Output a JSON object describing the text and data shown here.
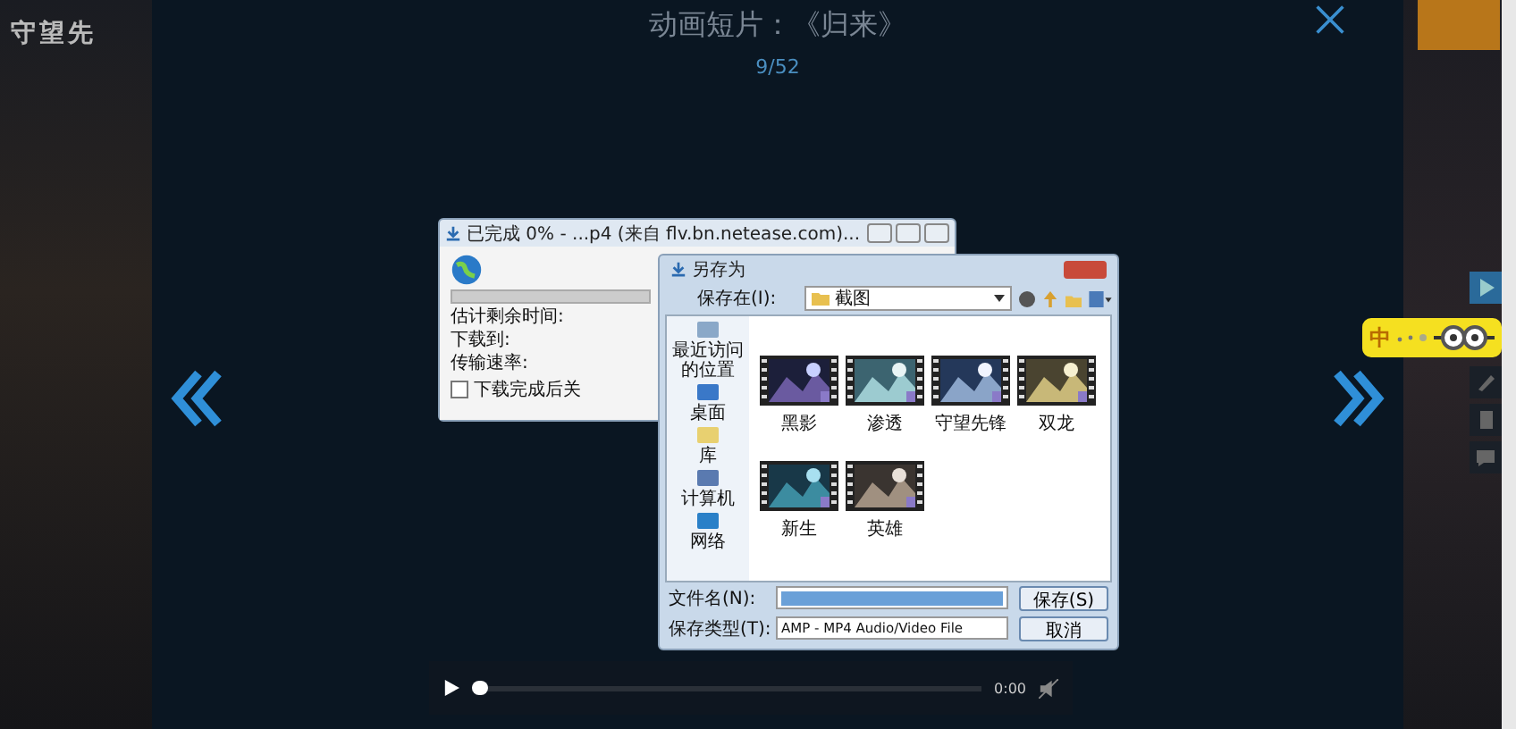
{
  "page": {
    "logo": "守望先"
  },
  "lightbox": {
    "title": "动画短片：《归来》",
    "counter": "9/52"
  },
  "download_dialog": {
    "title": "已完成 0% - ...p4 (来自 flv.bn.netease.com)...",
    "progress": {
      "level": 0
    },
    "labels": [
      "估计剩余时间:",
      "下载到:",
      "传输速率:"
    ],
    "checkbox": {
      "label": "下载完成后关",
      "checked": false
    }
  },
  "save_dialog": {
    "title": "另存为",
    "location_label": "保存在(I):",
    "location": "截图",
    "places": [
      "最近访问的位置",
      "桌面",
      "库",
      "计算机",
      "网络"
    ],
    "files": [
      {
        "name": "黑影"
      },
      {
        "name": "渗透"
      },
      {
        "name": "守望先锋"
      },
      {
        "name": "双龙"
      },
      {
        "name": "新生"
      },
      {
        "name": "英雄"
      }
    ],
    "filename_label": "文件名(N):",
    "filetype_label": "保存类型(T):",
    "filetype": "AMP - MP4 Audio/Video File",
    "buttons": [
      "保存(S)",
      "取消"
    ]
  },
  "player": {
    "progress": {
      "level": 0
    },
    "time": "0:00"
  },
  "ime": {
    "label": "中"
  }
}
